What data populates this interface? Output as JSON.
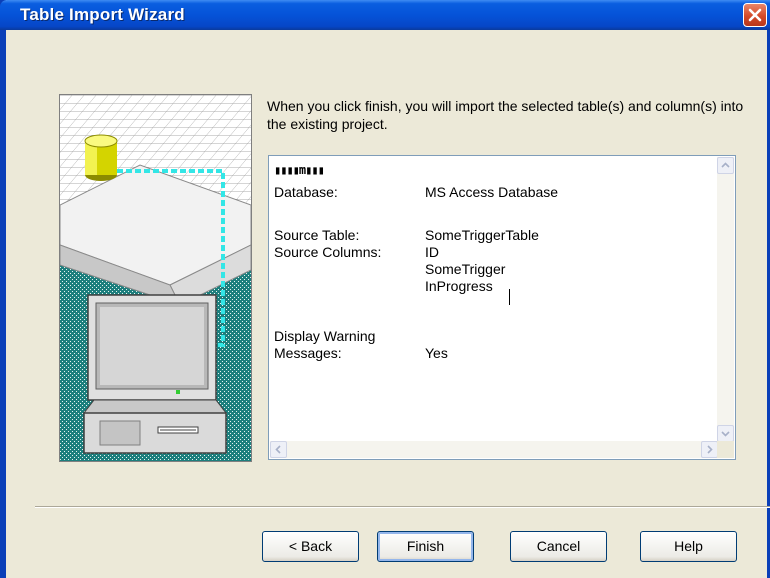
{
  "window": {
    "title": "Table Import Wizard",
    "close_icon": "close-icon",
    "accent_color": "#0553d8"
  },
  "intro": {
    "text": "When you click finish, you will import the selected table(s) and column(s) into the existing project."
  },
  "summary": {
    "header_glyphs": "▮▮▮▮m▮▮▮",
    "database_label": "Database:",
    "database_value": "MS Access Database",
    "source_table_label": "Source Table:",
    "source_table_value": "SomeTriggerTable",
    "source_columns_label": "Source Columns:",
    "source_columns": [
      "ID",
      "SomeTrigger",
      "InProgress"
    ],
    "warning_label_line1": "Display Warning",
    "warning_label_line2": "Messages:",
    "warning_value": "Yes"
  },
  "buttons": {
    "back": "< Back",
    "finish": "Finish",
    "cancel": "Cancel",
    "help": "Help"
  }
}
